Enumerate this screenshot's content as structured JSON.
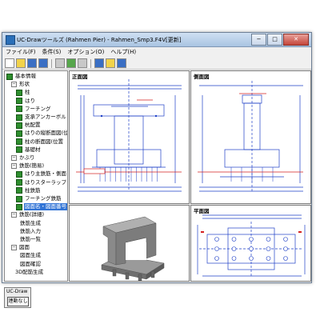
{
  "window": {
    "title": "UC-Drawツールズ (Rahmen Pier)  - Rahmen_Smp3.F4V[更新]",
    "min_label": "−",
    "max_label": "□",
    "close_label": "✕"
  },
  "menu": [
    "ファイル(F)",
    "条件(S)",
    "オプション(O)",
    "ヘルプ(H)"
  ],
  "toolbar_icons": [
    "new-icon",
    "open-icon",
    "save-icon",
    "save-as-icon",
    "print-icon",
    "check-icon",
    "export-icon",
    "import-icon",
    "help-icon",
    "info-icon"
  ],
  "tree": [
    {
      "label": "基本情報",
      "level": 0,
      "state": "checked"
    },
    {
      "label": "形状",
      "level": 1,
      "state": "expander"
    },
    {
      "label": "柱",
      "level": 2,
      "state": "checked"
    },
    {
      "label": "はり",
      "level": 2,
      "state": "checked"
    },
    {
      "label": "フーチング",
      "level": 2,
      "state": "checked"
    },
    {
      "label": "支承アンカーボルト",
      "level": 2,
      "state": "checked"
    },
    {
      "label": "杭配置",
      "level": 2,
      "state": "checked"
    },
    {
      "label": "はりの縦断面図(位",
      "level": 2,
      "state": "checked"
    },
    {
      "label": "柱の断面図(位置",
      "level": 2,
      "state": "checked"
    },
    {
      "label": "基礎材",
      "level": 2,
      "state": "checked"
    },
    {
      "label": "かぶり",
      "level": 1,
      "state": "expander"
    },
    {
      "label": "鉄筋(簡易)",
      "level": 1,
      "state": "expander"
    },
    {
      "label": "はり主鉄筋・側面",
      "level": 2,
      "state": "checked"
    },
    {
      "label": "はりスターラップ・F",
      "level": 2,
      "state": "checked"
    },
    {
      "label": "柱鉄筋",
      "level": 2,
      "state": "checked"
    },
    {
      "label": "フーチング鉄筋",
      "level": 2,
      "state": "checked"
    },
    {
      "label": "図面名・図面番号",
      "level": 2,
      "state": "selected"
    },
    {
      "label": "鉄筋(詳細)",
      "level": 1,
      "state": "expander"
    },
    {
      "label": "鉄筋生成",
      "level": 2,
      "state": "none"
    },
    {
      "label": "鉄筋入力",
      "level": 2,
      "state": "none"
    },
    {
      "label": "鉄筋一覧",
      "level": 2,
      "state": "none"
    },
    {
      "label": "図面",
      "level": 1,
      "state": "expander"
    },
    {
      "label": "図面生成",
      "level": 2,
      "state": "none"
    },
    {
      "label": "図面確認",
      "level": 2,
      "state": "none"
    },
    {
      "label": "3D配筋生成",
      "level": 1,
      "state": "none"
    }
  ],
  "launcher": {
    "caption": "UC-Draw",
    "button_label": "連動なし"
  },
  "panes": {
    "front": {
      "title": "正面図"
    },
    "side": {
      "title": "側面図"
    },
    "plan": {
      "title": "平面図"
    },
    "model3d": {
      "title": ""
    }
  },
  "colors": {
    "drawing_line": "#1e3fc7",
    "dimension": "#1e3fc7",
    "highlight": "#d42020",
    "selection": "#3375d6",
    "checkbox": "#2f8f2f"
  }
}
